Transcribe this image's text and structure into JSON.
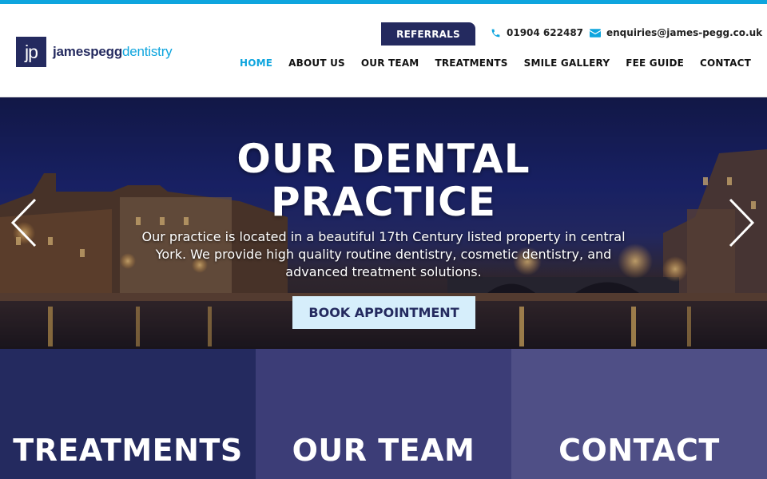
{
  "brand": {
    "logo_mark": "jp",
    "name_part1": "jamespegg",
    "name_part2": "dentistry",
    "colors": {
      "navy": "#242a5f",
      "accent": "#0ea5de"
    }
  },
  "header": {
    "referrals_label": "REFERRALS",
    "phone": "01904 622487",
    "email": "enquiries@james-pegg.co.uk",
    "phone_icon": "phone-icon",
    "email_icon": "envelope-icon"
  },
  "nav": {
    "items": [
      {
        "label": "HOME",
        "active": true
      },
      {
        "label": "ABOUT US",
        "active": false
      },
      {
        "label": "OUR TEAM",
        "active": false
      },
      {
        "label": "TREATMENTS",
        "active": false
      },
      {
        "label": "SMILE GALLERY",
        "active": false
      },
      {
        "label": "FEE GUIDE",
        "active": false
      },
      {
        "label": "CONTACT",
        "active": false
      }
    ]
  },
  "hero": {
    "title_line1": "OUR DENTAL",
    "title_line2": "PRACTICE",
    "description": "Our practice is located in a beautiful 17th Century listed property in central York. We provide high quality routine dentistry, cosmetic dentistry, and advanced treatment solutions.",
    "cta_label": "BOOK APPOINTMENT",
    "prev_icon": "chevron-left-icon",
    "next_icon": "chevron-right-icon"
  },
  "tiles": [
    {
      "label": "TREATMENTS",
      "color": "#242a5f"
    },
    {
      "label": "OUR TEAM",
      "color": "#3c3d77"
    },
    {
      "label": "CONTACT",
      "color": "#4f4f86"
    }
  ]
}
